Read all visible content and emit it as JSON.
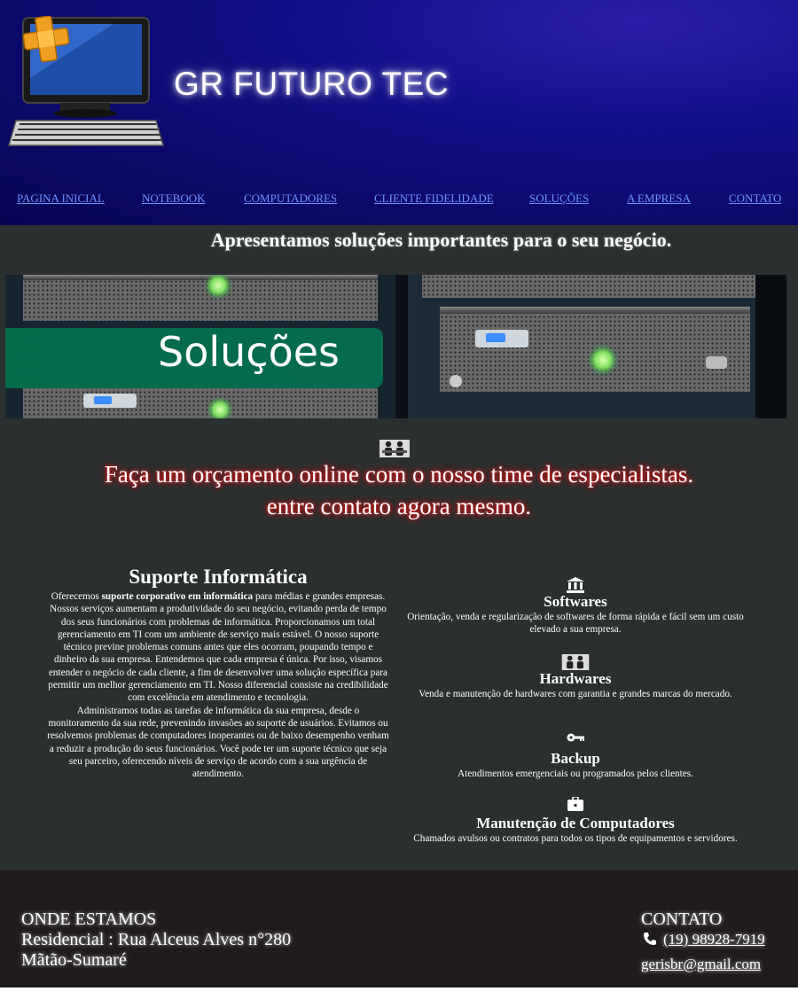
{
  "header": {
    "brand": "GR FUTURO TEC",
    "nav": [
      {
        "label": "PAGINA INICIAL"
      },
      {
        "label": "NOTEBOOK"
      },
      {
        "label": "COMPUTADORES"
      },
      {
        "label": "CLIENTE FIDELIDADE"
      },
      {
        "label": "SOLUÇÕES"
      },
      {
        "label": "A EMPRESA"
      },
      {
        "label": "CONTATO"
      }
    ]
  },
  "tagline": "Apresentamos soluções importantes para o seu negócio.",
  "banner": {
    "label": "Soluções"
  },
  "quote": {
    "line1": "Faça um orçamento online com o nosso time de especialistas.",
    "line2": "entre contato agora mesmo."
  },
  "support": {
    "title": "Suporte Informática",
    "p1_before": "Oferecemos ",
    "p1_bold": "suporte corporativo em informática",
    "p1_after": " para médias e grandes empresas. Nossos serviços aumentam a produtividade do seu negócio, evitando perda de tempo dos seus funcionários com problemas de informática. Proporcionamos um total gerenciamento em TI com um ambiente de serviço mais estável. O nosso suporte técnico previne problemas comuns antes que eles ocorram, poupando tempo e dinheiro da sua empresa. Entendemos que cada empresa é única. Por isso, visamos entender o negócio de cada cliente, a fim de desenvolver uma solução específica para permitir um melhor gerenciamento em TI. Nosso diferencial consiste na credibilidade com excelência em atendimento e tecnologia.",
    "p2": "Administramos todas as tarefas de informática da sua empresa, desde o monitoramento da sua rede, prevenindo invasões ao suporte de usuários. Evitamos ou resolvemos problemas de computadores inoperantes ou de baixo desempenho venham a reduzir a produção do seus funcionários. Você pode ter um suporte técnico que seja seu parceiro, oferecendo níveis de serviço de acordo com a sua urgência de atendimento."
  },
  "services": [
    {
      "icon": "bank-icon",
      "title": "Softwares",
      "text": "Orientação, venda e regularização de softwares de forma rápida e fácil sem um custo elevado a sua empresa."
    },
    {
      "icon": "team-icon",
      "title": "Hardwares",
      "text": "Venda e manutenção de hardwares com garantia e grandes marcas do mercado."
    },
    {
      "icon": "key-icon",
      "title": "Backup",
      "text": "Atendimentos emergenciais ou programados pelos clientes."
    },
    {
      "icon": "briefcase-icon",
      "title": "Manutenção de Computadores",
      "text": "Chamados avulsos ou contratos para todos os tipos de equipamentos e servidores."
    }
  ],
  "footer": {
    "location_title": "ONDE ESTAMOS",
    "address_line1": "Residencial : Rua Alceus Alves n°280",
    "address_line2": "Mãtão-Sumaré",
    "contact_title": "CONTATO",
    "phone": "(19) 98928-7919",
    "email": "gerisbr@gmail.com"
  },
  "colors": {
    "header_bg": "#0b0a6a",
    "nav_link": "#6f92ff",
    "section_bg": "#2a2f2f",
    "footer_bg": "#201c1c",
    "quote_glow": "#ff2020"
  }
}
